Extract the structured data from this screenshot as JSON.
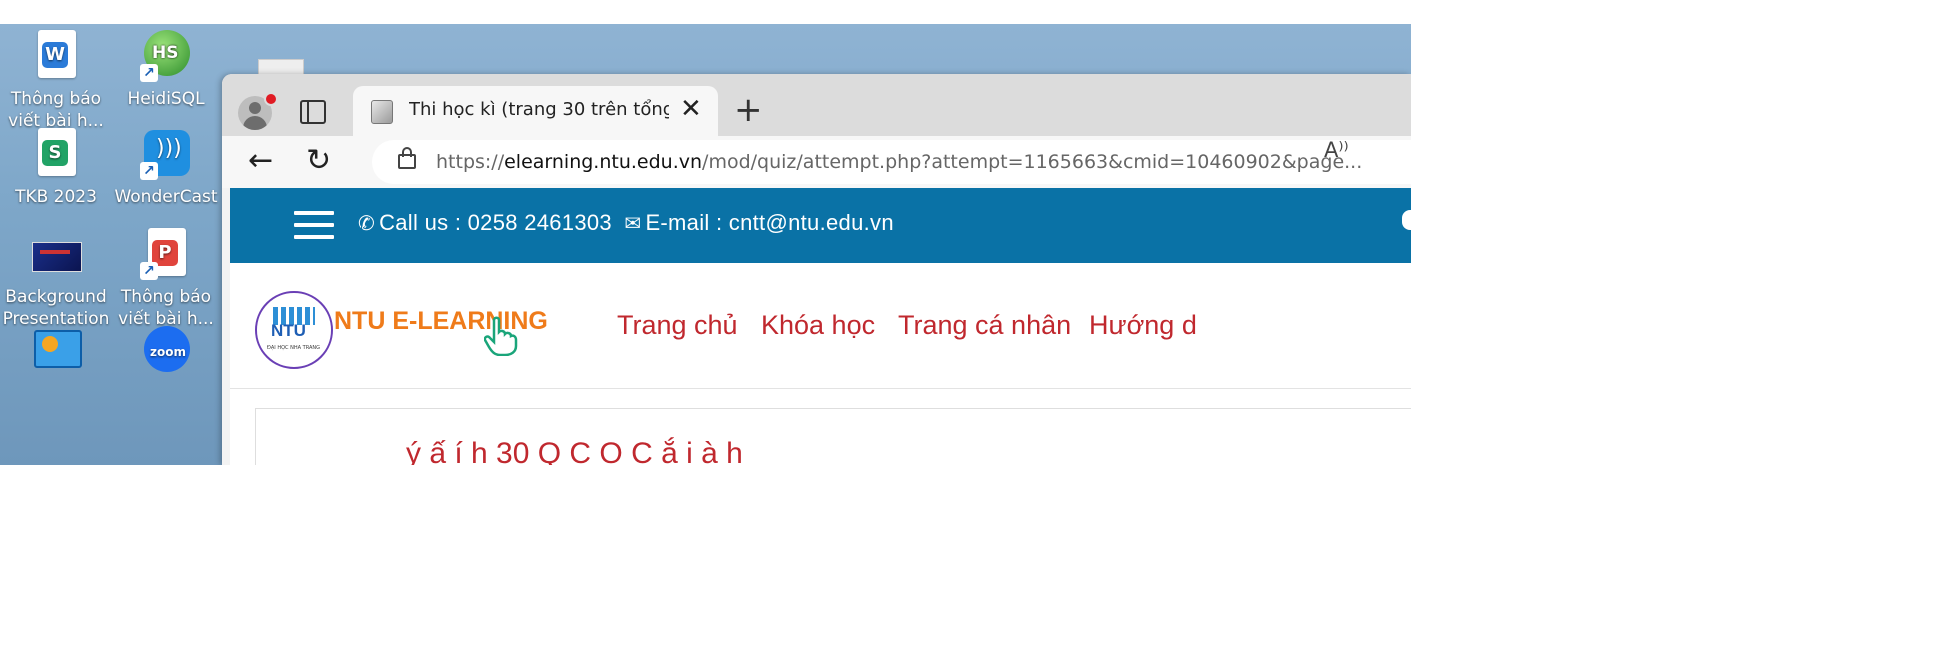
{
  "desktop": {
    "icons": [
      {
        "label": "Thông báo viết bài h...",
        "icon": "word-doc-icon"
      },
      {
        "label": "HeidiSQL",
        "icon": "heidisql-icon"
      },
      {
        "label": "TKB 2023",
        "icon": "spreadsheet-icon"
      },
      {
        "label": "WonderCast",
        "icon": "wondercast-icon"
      },
      {
        "label": "Background Presentation",
        "icon": "presentation-thumbnail-icon"
      },
      {
        "label": "Thông báo viết bài h...",
        "icon": "pdf-doc-icon"
      },
      {
        "label": "",
        "icon": "control-panel-icon"
      },
      {
        "label": "",
        "icon": "zoom-icon"
      }
    ]
  },
  "browser": {
    "tab": {
      "title": "Thi học kì (trang 30 trên tổng số",
      "close": "✕"
    },
    "new_tab": "+",
    "back": "←",
    "reload": "↻",
    "url": {
      "scheme": "https://",
      "domain": "elearning.ntu.edu.vn",
      "path": "/mod/quiz/attempt.php?attempt=1165663&cmid=10460902&page..."
    },
    "read_aloud": "A⁾⁾"
  },
  "site": {
    "topbar": {
      "phone_icon": "phone-icon",
      "phone_text": "Call us : 0258 2461303",
      "email_icon": "envelope-icon",
      "email_text": "E-mail : cntt@ntu.edu.vn"
    },
    "logo_text": "NTU",
    "logo_sub": "ĐẠI HỌC NHA TRANG",
    "brand": "NTU E-LEARNING",
    "menu": [
      "Trang chủ",
      "Khóa học",
      "Trang cá nhân",
      "Hướng d"
    ],
    "heading_peek": "ý   ấ  í  h    30 Q      C   O   C    ắ     i   à  h"
  },
  "colors": {
    "topbar": "#0a72a6",
    "menu": "#c0282e",
    "brand": "#ef7b1a"
  }
}
